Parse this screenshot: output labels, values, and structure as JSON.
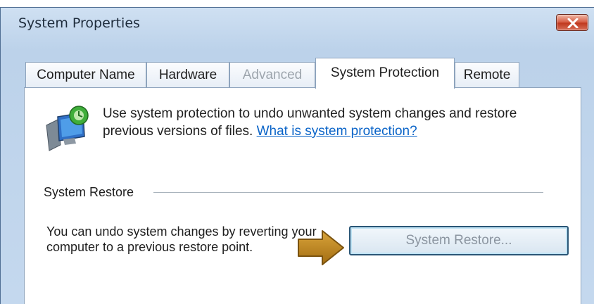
{
  "window": {
    "title": "System Properties"
  },
  "tabs": [
    {
      "label": "Computer Name",
      "state": "normal"
    },
    {
      "label": "Hardware",
      "state": "normal"
    },
    {
      "label": "Advanced",
      "state": "disabled"
    },
    {
      "label": "System Protection",
      "state": "active"
    },
    {
      "label": "Remote",
      "state": "normal"
    }
  ],
  "intro": {
    "icon": "system-protection-icon",
    "text": "Use system protection to undo unwanted system changes and restore previous versions of files.",
    "link": "What is system protection?"
  },
  "system_restore": {
    "group_label": "System Restore",
    "description": "You can undo system changes by reverting your computer to a previous restore point.",
    "button_label": "System Restore..."
  },
  "annotation": {
    "icon": "pointer-arrow-icon",
    "color": "#c58a1c"
  },
  "colors": {
    "link": "#0a64c8",
    "close_button": "#c0391f",
    "button_border": "#2b5676"
  }
}
